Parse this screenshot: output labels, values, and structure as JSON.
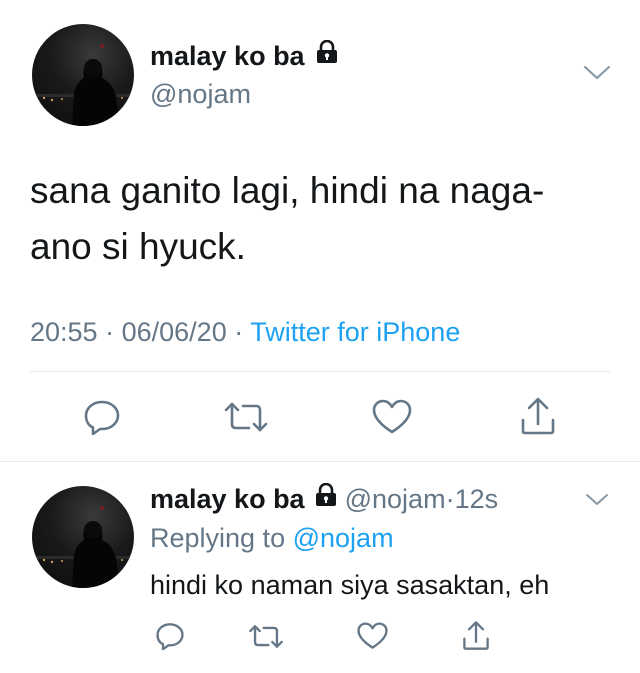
{
  "main_tweet": {
    "display_name": "malay ko ba",
    "handle": "@nojam",
    "text_line1": "sana ganito lagi, hindi na naga-",
    "text_line2": "ano si hyuck.",
    "time": "20:55",
    "sep1": "·",
    "date": "06/06/20",
    "sep2": "·",
    "source": "Twitter for iPhone"
  },
  "reply": {
    "display_name": "malay ko ba",
    "handle": "@nojam",
    "sep": "·",
    "age": "12s",
    "replying_prefix": "Replying to",
    "replying_handle": "@nojam",
    "text": "hindi ko naman siya sasaktan, eh"
  },
  "icons": {
    "lock": "lock-icon",
    "chevron": "chevron-down-icon",
    "reply": "reply-icon",
    "retweet": "retweet-icon",
    "like": "heart-icon",
    "share": "share-icon"
  },
  "colors": {
    "text": "#14171a",
    "secondary": "#657786",
    "link": "#1da1f2",
    "divider": "#e1e8ed"
  }
}
